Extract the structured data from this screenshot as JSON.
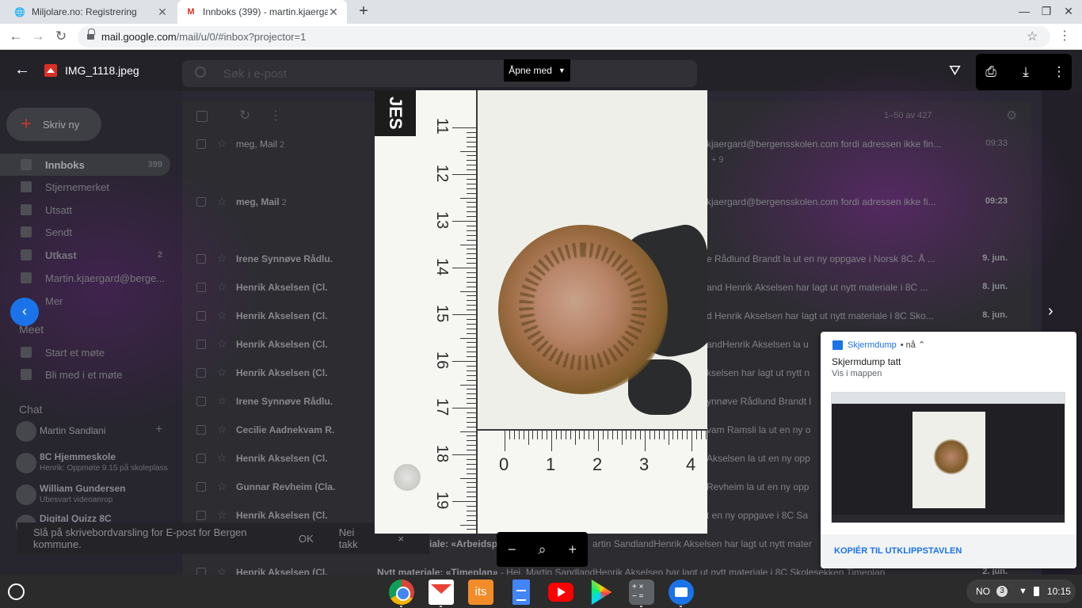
{
  "browser": {
    "tabs": [
      {
        "title": "Miljolare.no: Registrering"
      },
      {
        "title": "Innboks (399) - martin.kjaergard"
      }
    ],
    "url_host": "mail.google.com",
    "url_path": "/mail/u/0/#inbox?projector=1"
  },
  "gmail_bg": {
    "search_placeholder": "Søk i e-post",
    "compose_label": "Skriv ny",
    "nav": [
      {
        "label": "Innboks",
        "count": "399"
      },
      {
        "label": "Stjernemerket",
        "count": ""
      },
      {
        "label": "Utsatt",
        "count": ""
      },
      {
        "label": "Sendt",
        "count": ""
      },
      {
        "label": "Utkast",
        "count": "2"
      },
      {
        "label": "Martin.kjaergard@berge...",
        "count": ""
      },
      {
        "label": "Mer",
        "count": ""
      }
    ],
    "meet_header": "Meet",
    "meet_items": [
      "Start et møte",
      "Bli med i et møte"
    ],
    "chat_header": "Chat",
    "chat_user": "Martin Sandlani",
    "chat_items": [
      {
        "name": "8C Hjemmeskole",
        "sub": "Henrik: Oppmøte 9.15 på skoleplass"
      },
      {
        "name": "William Gundersen",
        "sub": "Ubesvart videoanrop"
      },
      {
        "name": "Digital Quizz 8C",
        "sub": ""
      }
    ],
    "pagination": "1–50 av 427",
    "emails": [
      {
        "sender": "meg, Mail",
        "count": "2",
        "preview": "kjaergard@bergensskolen.com fordi adressen ikke fin...",
        "date": "09:33",
        "extra": "+ 9"
      },
      {
        "sender": "meg, Mail",
        "count": "2",
        "preview": "kjaergard@bergensskolen.com fordi adressen ikke fi...",
        "date": "09:23",
        "extra": ""
      },
      {
        "sender": "Irene Synnøve Rådlu.",
        "count": "",
        "preview": "e Rådlund Brandt la ut en ny oppgave i Norsk 8C. Å ...",
        "date": "9. jun.",
        "extra": ""
      },
      {
        "sender": "Henrik Akselsen (Cl.",
        "count": "",
        "preview": "and Henrik Akselsen har lagt ut nytt materiale i 8C ...",
        "date": "8. jun.",
        "extra": ""
      },
      {
        "sender": "Henrik Akselsen (Cl.",
        "count": "",
        "preview": "d Henrik Akselsen har lagt ut nytt materiale i 8C Sko...",
        "date": "8. jun.",
        "extra": ""
      },
      {
        "sender": "Henrik Akselsen (Cl.",
        "count": "",
        "preview": "andHenrik Akselsen la u",
        "date": "",
        "extra": ""
      },
      {
        "sender": "Henrik Akselsen (Cl.",
        "count": "",
        "preview": "kselsen har lagt ut nytt n",
        "date": "",
        "extra": ""
      },
      {
        "sender": "Irene Synnøve Rådlu.",
        "count": "",
        "preview": "ynnøve Rådlund Brandt l",
        "date": "",
        "extra": ""
      },
      {
        "sender": "Cecilie Aadnekvam R.",
        "count": "",
        "preview": "vam Ramsli la ut en ny o",
        "date": "",
        "extra": ""
      },
      {
        "sender": "Henrik Akselsen (Cl.",
        "count": "",
        "preview": "Akselsen la ut en ny opp",
        "date": "",
        "extra": ""
      },
      {
        "sender": "Gunnar Revheim (Cla.",
        "count": "",
        "preview": "Revheim la ut en ny opp",
        "date": "",
        "extra": ""
      },
      {
        "sender": "Henrik Akselsen (Cl.",
        "count": "",
        "preview": "t en ny oppgave i 8C Sa",
        "date": "",
        "extra": ""
      },
      {
        "sender": "",
        "count": "",
        "preview": "iale: «Arbeidsp",
        "preview_tail": "artin SandlandHenrik Akselsen har lagt ut nytt mater",
        "date": "",
        "extra": ""
      },
      {
        "sender": "Henrik Akselsen (Cl.",
        "count": "",
        "preview": "Nytt materiale: «Timeplan»",
        "preview_tail": " - Hei, Martin SandlandHenrik Akselsen har lagt ut nytt materiale i 8C Skolesekken Timeplan",
        "date": "2. jun.",
        "extra": ""
      }
    ],
    "banner": {
      "text": "Slå på skrivebordvarsling for E-post for Bergen kommune.",
      "ok": "OK",
      "no": "Nei takk",
      "close": "×"
    }
  },
  "viewer": {
    "filename": "IMG_1118.jpeg",
    "open_with": "Åpne med",
    "photo": {
      "brand_text": "JES",
      "vertical_ruler": [
        "11",
        "12",
        "13",
        "14",
        "15",
        "16",
        "17",
        "18",
        "19"
      ],
      "horizontal_ruler": [
        "0",
        "1",
        "2",
        "3",
        "4"
      ]
    },
    "zoom": {
      "out": "−",
      "zoom": "⌕",
      "in": "+"
    }
  },
  "notification": {
    "app": "Skjermdump",
    "when": "nå",
    "title": "Skjermdump tatt",
    "subtitle": "Vis i mappen",
    "action": "KOPIÉR TIL UTKLIPPSTAVLEN"
  },
  "shelf": {
    "apps": [
      "Chrome",
      "Gmail",
      "itslearning",
      "Docs",
      "YouTube",
      "Play Store",
      "Kalkulator",
      "Filer"
    ],
    "its_label": "its",
    "ime": "NO",
    "notif_count": "3",
    "time": "10:15"
  },
  "colors": {
    "accent": "#1a73e8",
    "gmail_red": "#d93025",
    "viewer_black": "#000000"
  }
}
